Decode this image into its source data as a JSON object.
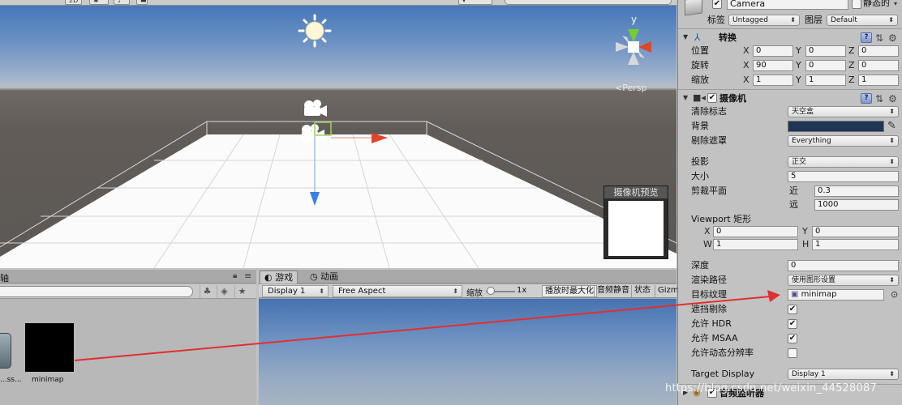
{
  "scene": {
    "gizmo": {
      "y_axis": "y",
      "persp_label": "<Persp"
    },
    "camera_preview": {
      "title": "摄像机预览"
    }
  },
  "project": {
    "tab_label": "轴",
    "tools": [
      "search-by-type-icon",
      "search-by-label-icon",
      "favorite-star-icon"
    ],
    "assets": [
      {
        "label": "...ss..."
      },
      {
        "label": "minimap"
      }
    ]
  },
  "game": {
    "tabs": [
      {
        "label": "游戏",
        "icon": "game-controller-icon"
      },
      {
        "label": "动画",
        "icon": "animation-clock-icon"
      }
    ],
    "toolbar": {
      "display": "Display 1",
      "aspect": "Free Aspect",
      "scale_label": "缩放",
      "scale_value": "1x",
      "maximize_on_play": "播放时最大化",
      "mute_audio": "音频静音",
      "stats": "状态",
      "gizmos": "Gizm"
    }
  },
  "inspector": {
    "header": {
      "name": "Camera",
      "static_label": "静态的",
      "tag_label": "标签",
      "tag_value": "Untagged",
      "layer_label": "图层",
      "layer_value": "Default"
    },
    "transform": {
      "title": "转换",
      "position": {
        "label": "位置",
        "x": "0",
        "y": "0",
        "z": "0"
      },
      "rotation": {
        "label": "旋转",
        "x": "90",
        "y": "0",
        "z": "0"
      },
      "scale": {
        "label": "缩放",
        "x": "1",
        "y": "1",
        "z": "1"
      },
      "axis_x": "X",
      "axis_y": "Y",
      "axis_z": "Z"
    },
    "camera": {
      "title": "摄像机",
      "clear_flags": {
        "label": "清除标志",
        "value": "天空盒"
      },
      "background": {
        "label": "背景",
        "color": "#1e3556"
      },
      "culling_mask": {
        "label": "剔除遮罩",
        "value": "Everything"
      },
      "projection": {
        "label": "投影",
        "value": "正交"
      },
      "size": {
        "label": "大小",
        "value": "5"
      },
      "clipping": {
        "label": "剪裁平面",
        "near_label": "近",
        "near": "0.3",
        "far_label": "远",
        "far": "1000"
      },
      "viewport": {
        "label": "Viewport 矩形",
        "x_label": "X",
        "x": "0",
        "y_label": "Y",
        "y": "0",
        "w_label": "W",
        "w": "1",
        "h_label": "H",
        "h": "1"
      },
      "depth": {
        "label": "深度",
        "value": "0"
      },
      "rendering_path": {
        "label": "渲染路径",
        "value": "使用图形设置"
      },
      "target_texture": {
        "label": "目标纹理",
        "value": "minimap"
      },
      "occlusion_culling": {
        "label": "遮挡剔除",
        "checked": true
      },
      "allow_hdr": {
        "label": "允许 HDR",
        "checked": true
      },
      "allow_msaa": {
        "label": "允许 MSAA",
        "checked": true
      },
      "dynamic_resolution": {
        "label": "允许动态分辨率",
        "checked": false
      },
      "target_display": {
        "label": "Target Display",
        "value": "Display 1"
      }
    },
    "audio_listener": {
      "title": "音频监听器"
    }
  },
  "watermark": "https://blog.csdn.net/weixin_44528087",
  "colors": {
    "arrow": "#e03030",
    "gizmo_y": "#6fd02e",
    "gizmo_x": "#e2452a",
    "selection": "#9fcf5a"
  }
}
